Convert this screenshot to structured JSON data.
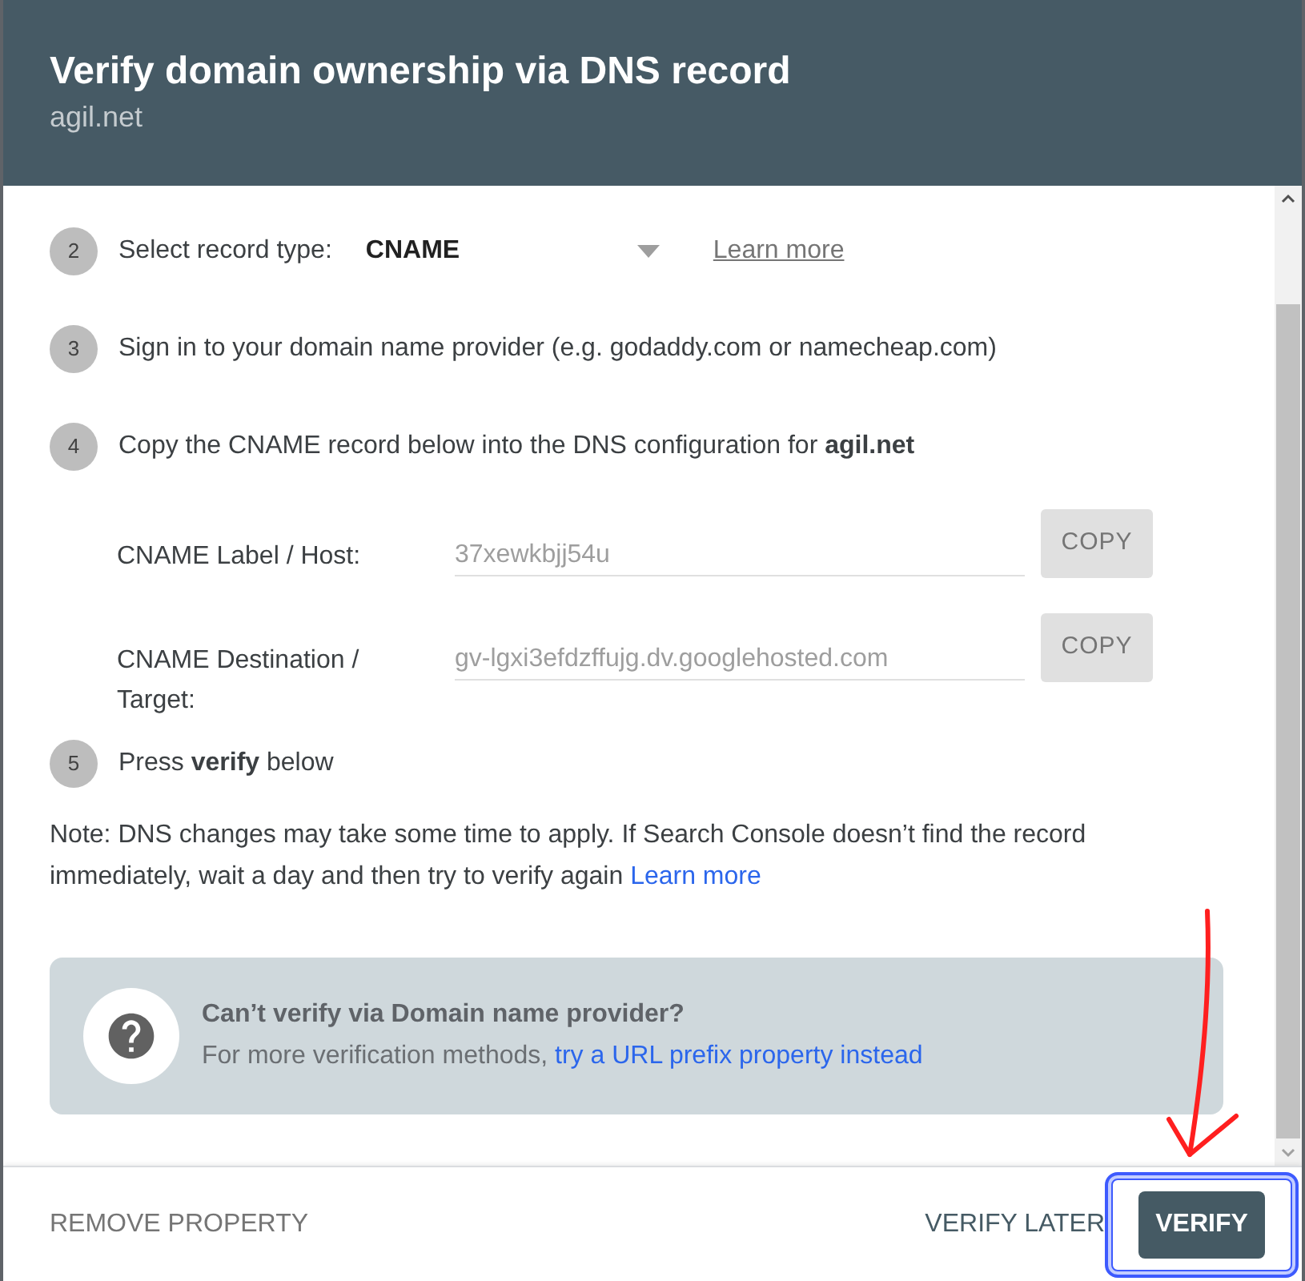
{
  "dialog": {
    "title": "Verify domain ownership via DNS record",
    "subtitle": "agil.net"
  },
  "steps": [
    {
      "kind": "select",
      "number": "2",
      "label": "Select record type:",
      "value": "CNAME",
      "link": "Learn more"
    },
    {
      "kind": "text",
      "number": "3",
      "text": "Sign in to your domain name provider (e.g. godaddy.com or namecheap.com)"
    },
    {
      "kind": "fields",
      "number": "4",
      "text": "Copy the CNAME record below into the DNS configuration for **agil.net**",
      "fields": [
        {
          "label": "CNAME Label / Host:",
          "value": "37xewkbjj54u",
          "button": "COPY"
        },
        {
          "label": "CNAME Destination / Target:",
          "value": "gv-lgxi3efdzffujg.dv.googlehosted.com",
          "button": "COPY"
        }
      ]
    },
    {
      "kind": "text",
      "number": "5",
      "text": "Press **verify** below"
    }
  ],
  "note": {
    "text": "Note: DNS changes may take some time to apply. If Search Console doesn’t find the record immediately, wait a day and then try to verify again",
    "link": "Learn more"
  },
  "info_box": {
    "title": "Can’t verify via Domain name provider?",
    "text": "For more verification methods,",
    "link": "try a URL prefix property instead"
  },
  "footer": {
    "remove_button": "REMOVE PROPERTY",
    "buttons": [
      {
        "kind": "text",
        "label": "VERIFY LATER"
      },
      {
        "kind": "primary",
        "label": "VERIFY"
      }
    ]
  }
}
